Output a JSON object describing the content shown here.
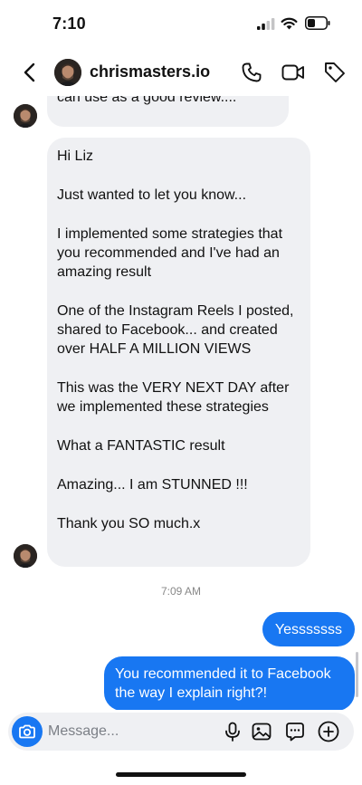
{
  "status_bar": {
    "time": "7:10"
  },
  "header": {
    "contact_name": "chrismasters.io"
  },
  "conversation": {
    "incoming_top": "can use as a good review....",
    "incoming_main": [
      "Hi Liz",
      "Just wanted to let you know...",
      "I implemented some strategies that you recommended and I've had an amazing result",
      "One of the Instagram Reels I posted, shared to Facebook... and created over HALF A MILLION VIEWS",
      "This was the VERY NEXT DAY after we implemented these strategies",
      "What a FANTASTIC result",
      "Amazing... I am STUNNED !!!",
      "Thank you SO much.x"
    ],
    "timestamp": "7:09 AM",
    "outgoing": [
      "Yesssssss",
      "You recommended it to Facebook the way I explain right?!"
    ]
  },
  "composer": {
    "placeholder": "Message..."
  },
  "colors": {
    "accent": "#1877f2",
    "incoming_bubble": "#eff0f3"
  }
}
